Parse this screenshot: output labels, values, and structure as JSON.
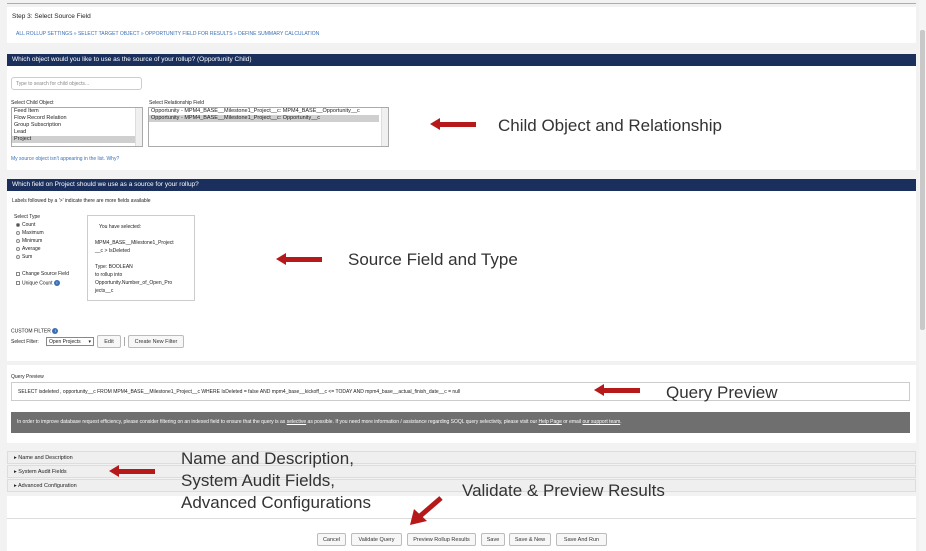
{
  "step": {
    "title": "Step 3: Select Source Field",
    "breadcrumb": "ALL ROLLUP SETTINGS » SELECT TARGET OBJECT » OPPORTUNITY FIELD FOR RESULTS » DEFINE SUMMARY CALCULATION"
  },
  "source_object": {
    "header": "Which object would you like to use as the source of your rollup? (Opportunity Child)",
    "search_placeholder": "Type to search for child objects...",
    "child_label": "Select Child Object",
    "child_items": [
      "Feed Item",
      "Flow Record Relation",
      "Group Subscription",
      "Lead",
      "Project"
    ],
    "relationship_label": "Select Relationship Field",
    "relationship_items": [
      "Opportunity - MPM4_BASE__Milestone1_Project__c: MPM4_BASE__Opportunity__c",
      "Opportunity - MPM4_BASE__Milestone1_Project__c: Opportunity__c"
    ],
    "missing_link": "My source object isn't appearing in the list. Why?"
  },
  "source_field": {
    "header": "Which field on Project should we use as a source for your rollup?",
    "hint": "Labels followed by a '>' indicate there are more fields available",
    "type_label": "Select Type",
    "types": [
      "Count",
      "Maximum",
      "Minimum",
      "Average",
      "Sum"
    ],
    "change_source": "Change Source Field",
    "unique_count": "Unique Count",
    "selection": {
      "line1": "You have selected:",
      "line2": "MPM4_BASE__Milestone1_Project",
      "line3": "__c > IsDeleted",
      "line4": "Type: BOOLEAN",
      "line5": "to rollup into",
      "line6": "Opportunity.Number_of_Open_Pro",
      "line7": "jects__c"
    }
  },
  "custom_filter": {
    "label": "CUSTOM FILTER",
    "select_label": "Select Filter:",
    "selected": "Open Projects",
    "edit": "Edit",
    "create": "Create New Filter"
  },
  "query": {
    "label": "Query Preview",
    "text": "SELECT isdeleted , opportunity__c FROM MPM4_BASE__Milestone1_Project__c WHERE IsDeleted = false AND mpm4_base__kickoff__c <= TODAY AND mpm4_base__actual_finish_date__c = null",
    "notice": "In order to improve database request efficiency, please consider filtering on an indexed field to ensure that the query is as",
    "notice_selective": "selective",
    "notice_mid": "as possible. If you need more information / assistance regarding SOQL query selectivity, please visit our",
    "help_link": "Help Page",
    "notice_or": "or email",
    "support_link": "our support team"
  },
  "accordions": [
    "Name and Description",
    "System Audit Fields",
    "Advanced Configuration"
  ],
  "buttons": [
    "Cancel",
    "Validate Query",
    "Preview Rollup Results",
    "Save",
    "Save & New",
    "Save And Run"
  ],
  "annotations": {
    "child_object": "Child Object and Relationship",
    "source_field": "Source Field and Type",
    "query_preview": "Query Preview",
    "sections_1": "Name and Description,",
    "sections_2": "System Audit Fields,",
    "sections_3": "Advanced Configurations",
    "validate": "Validate & Preview Results"
  },
  "colors": {
    "header_bg": "#1b2f5c",
    "arrow": "#b5191a",
    "notice_bg": "#6f6f6f",
    "link": "#3b6fb6"
  }
}
